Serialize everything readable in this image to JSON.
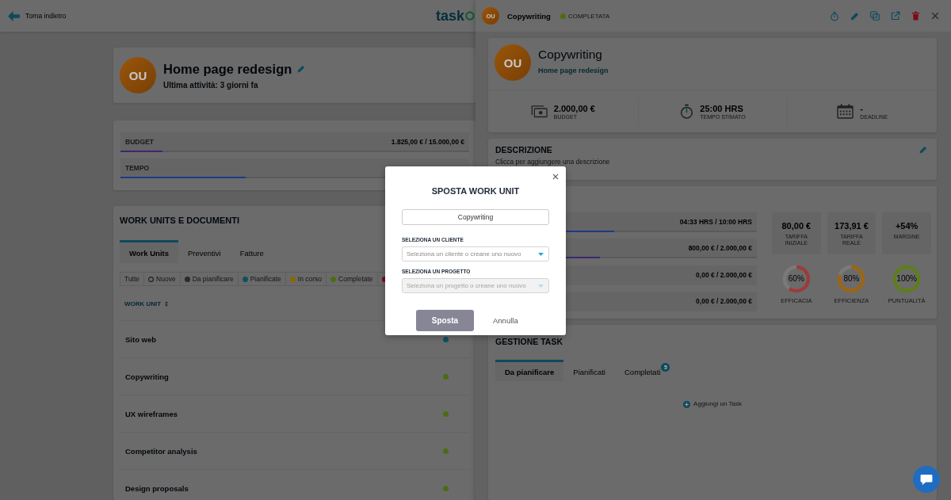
{
  "top_bar": {
    "back_label": "Torna indietro",
    "logo_text": "task"
  },
  "project": {
    "avatar": "OU",
    "title": "Home page redesign",
    "last_activity": "Ultima attività: 3 giorni fa"
  },
  "project_progress": [
    {
      "label": "BUDGET",
      "value": "1.825,00 € / 15.000,00 €",
      "level": 0.12,
      "color": "#3d2770"
    },
    {
      "label": "TEMPO",
      "level": 0.36,
      "color": "#1c3b85"
    }
  ],
  "work_units": {
    "title": "WORK UNITS E DOCUMENTI",
    "tabs": [
      {
        "label": "Work Units",
        "selected": true
      },
      {
        "label": "Preventivi",
        "selected": false
      },
      {
        "label": "Fatture",
        "selected": false
      }
    ],
    "filters": [
      {
        "kind": "plain",
        "label": "Tutte"
      },
      {
        "kind": "ring",
        "label": "Nuove"
      },
      {
        "kind": "dot",
        "label": "Da pianificare",
        "color": "#2a2a2a"
      },
      {
        "kind": "dot",
        "label": "Pianificate",
        "color": "#0e5163"
      },
      {
        "kind": "dot",
        "label": "In corso",
        "color": "#8a6800"
      },
      {
        "kind": "dot",
        "label": "Completate",
        "color": "#4f6b12"
      },
      {
        "kind": "dot",
        "color": "#7d0b16"
      }
    ],
    "column": "WORK UNIT",
    "rows": [
      {
        "name": "Sito web",
        "color": "#0e5163"
      },
      {
        "name": "Copywriting",
        "color": "#4f6b12"
      },
      {
        "name": "UX wireframes",
        "color": "#4f6b12"
      },
      {
        "name": "Competitor analysis",
        "color": "#4f6b12"
      },
      {
        "name": "Design proposals",
        "color": "#4f6b12"
      }
    ]
  },
  "panel": {
    "header": {
      "avatar": "OU",
      "name": "Copywriting",
      "status": {
        "label": "COMPLETATA",
        "color": "#4f6b12"
      }
    },
    "summary": {
      "avatar": "OU",
      "title": "Copywriting",
      "project_link": "Home page redesign",
      "stats": [
        {
          "kind": "money",
          "value": "2.000,00 €",
          "label": "BUDGET"
        },
        {
          "kind": "timer",
          "value": "25:00 HRS",
          "label": "TEMPO STIMATO"
        },
        {
          "kind": "calendar",
          "value": "-",
          "label": "DEADLINE"
        }
      ]
    },
    "description": {
      "title": "DESCRIZIONE",
      "hint": "Clicca per aggiungere una descrizione"
    },
    "progress": [
      {
        "value": "04:33 HRS / 10:00 HRS",
        "level": 0.455,
        "color": "#1c3b85"
      },
      {
        "value": "800,00 € / 2.000,00 €",
        "level": 0.4,
        "color": "#3d2770"
      },
      {
        "value": "0,00 € / 2.000,00 €"
      },
      {
        "value": "0,00 € / 2.000,00 €"
      }
    ],
    "metrics": [
      {
        "value": "80,00 €",
        "label": "TARIFFA INIZIALE"
      },
      {
        "value": "173,91 €",
        "label": "TARIFFA REALE"
      },
      {
        "value": "+54%",
        "label": "MARGINE"
      }
    ],
    "rings": [
      {
        "value": "60%",
        "label": "EFFICACIA",
        "level": 0.6,
        "color": "#9a3c3c"
      },
      {
        "value": "80%",
        "label": "EFFICIENZA",
        "level": 0.8,
        "color": "#9a6514"
      },
      {
        "value": "100%",
        "label": "PUNTUALITÀ",
        "level": 1,
        "color": "#5e7d1c"
      }
    ],
    "tasks": {
      "title": "GESTIONE TASK",
      "tabs": [
        {
          "label": "Da pianificare",
          "selected": true
        },
        {
          "label": "Pianificati",
          "selected": false
        },
        {
          "label": "Completati",
          "selected": false,
          "badge": "5"
        }
      ],
      "add_label": "Aggiungi un Task"
    }
  },
  "modal": {
    "title": "SPOSTA WORK UNIT",
    "name_value": "Copywriting",
    "fields": [
      {
        "label": "SELEZIONA UN CLIENTE",
        "placeholder": "Seleziona un cliente o creane uno nuovo",
        "disabled": false
      },
      {
        "label": "SELEZIONA UN PROGETTO",
        "placeholder": "Seleziona un progetto o creane uno nuovo",
        "disabled": true
      }
    ],
    "confirm": "Sposta",
    "cancel": "Annulla"
  }
}
